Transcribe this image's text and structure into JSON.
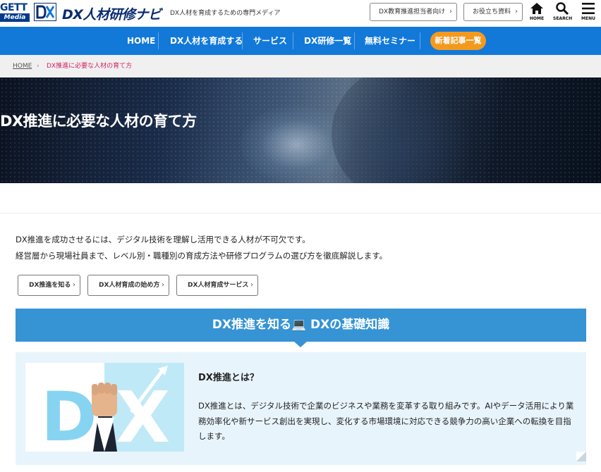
{
  "header": {
    "logo_gett_top": "GETT",
    "logo_gett_bottom": "Media",
    "logo_dx_icon": "dx-logo-icon",
    "brand": "DX人材研修ナビ",
    "tagline": "DX人材を育成するための専門メディア",
    "button_promoter": "DX教育推進担当者向け",
    "button_resources": "お役立ち資料",
    "icons": [
      {
        "name": "home-icon",
        "label": "HOME"
      },
      {
        "name": "search-icon",
        "label": "SEARCH"
      },
      {
        "name": "menu-icon",
        "label": "MENU"
      }
    ],
    "brand_color": "#0a2c70"
  },
  "nav": {
    "items": [
      "HOME",
      "DX人材を育成する",
      "サービス",
      "DX研修一覧",
      "無料セミナー"
    ],
    "cta": "新着記事一覧",
    "background": "#1279d9",
    "cta_color": "#f39a1e"
  },
  "breadcrumb": {
    "home": "HOME",
    "current": "DX推進に必要な人材の育て方",
    "current_color": "#d32060"
  },
  "hero": {
    "title": "DX推進に必要な人材の育て方"
  },
  "intro": {
    "line1": "DX推進を成功させるには、デジタル技術を理解し活用できる人材が不可欠です。",
    "line2": "経営層から現場社員まで、レベル別・職種別の育成方法や研修プログラムの選び方を徹底解説します。"
  },
  "jump_links": [
    "DX推進を知る",
    "DX人材育成の始め方",
    "DX人材育成サービス"
  ],
  "section": {
    "title": "DX推進を知る💻 DXの基礎知識",
    "band_color": "#3693d4"
  },
  "card": {
    "image_letters": "DX",
    "heading": "DX推進とは？",
    "body": "DX推進とは、デジタル技術で企業のビジネスや業務を変革する取り組みです。AIやデータ活用により業務効率化や新サービス創出を実現し、変化する市場環境に対応できる競争力の高い企業への転換を目指します。",
    "background": "#e8f4fb"
  }
}
